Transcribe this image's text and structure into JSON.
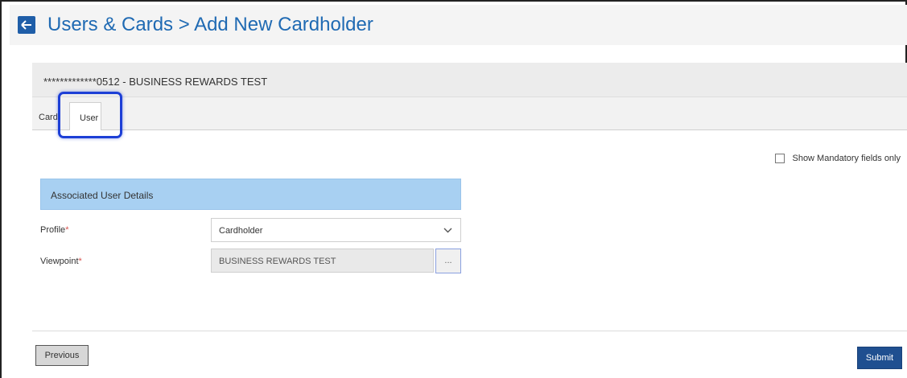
{
  "header": {
    "back_icon": "arrow-left-icon",
    "title": "Users & Cards > Add New Cardholder"
  },
  "card": {
    "number_label": "*************0512 - BUSINESS REWARDS TEST"
  },
  "tabs": [
    {
      "label": "Card",
      "active": false
    },
    {
      "label": "User",
      "active": true
    }
  ],
  "options": {
    "mandatory_only_label": "Show Mandatory fields only",
    "mandatory_only_checked": false
  },
  "section": {
    "title": "Associated User Details"
  },
  "fields": {
    "profile": {
      "label": "Profile",
      "required_mark": "*",
      "value": "Cardholder"
    },
    "viewpoint": {
      "label": "Viewpoint",
      "required_mark": "*",
      "value": "BUSINESS REWARDS TEST",
      "lookup_label": "..."
    }
  },
  "footer": {
    "previous_label": "Previous",
    "submit_label": "Submit"
  },
  "colors": {
    "accent": "#1f6ab3",
    "section_header": "#a8d0f2",
    "highlight": "#1d3fd6",
    "submit": "#1f4f90"
  }
}
